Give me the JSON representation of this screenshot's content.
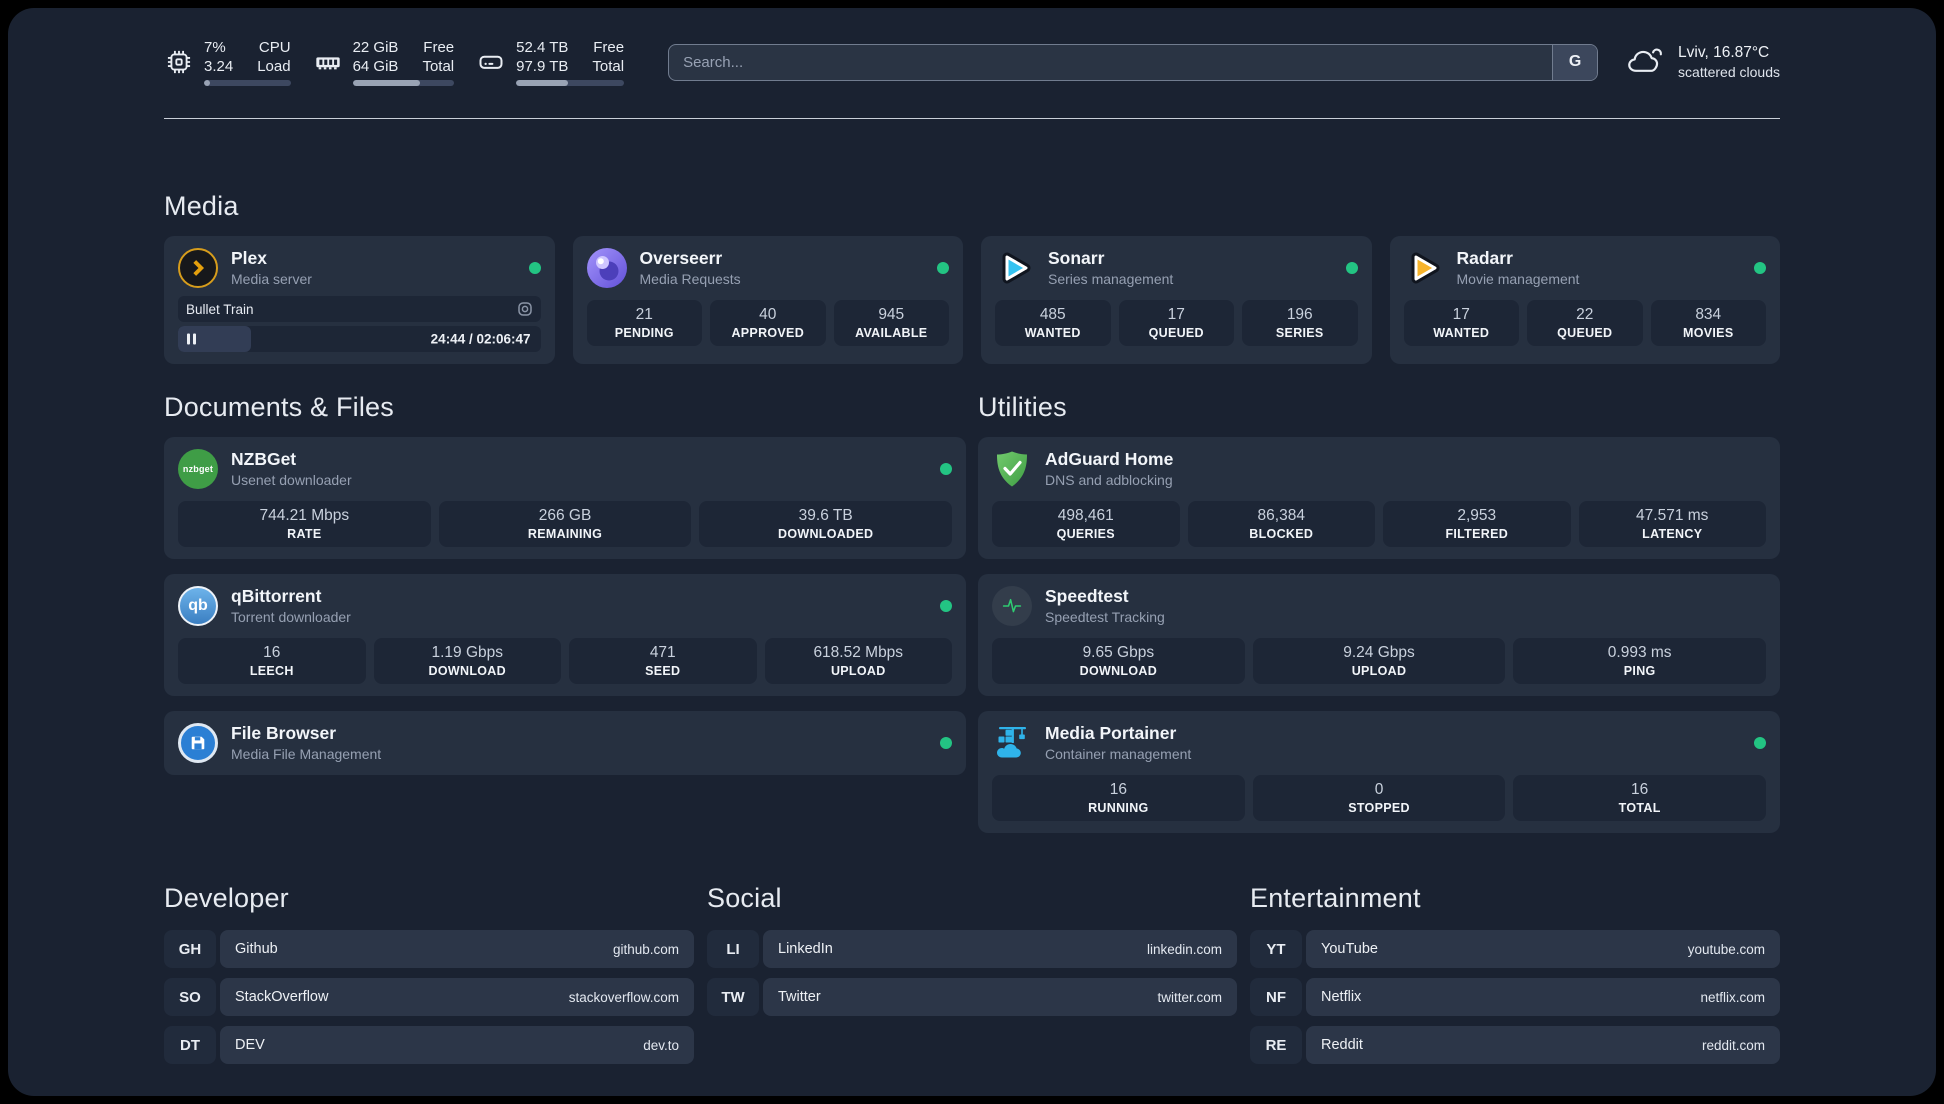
{
  "system": {
    "cpu": {
      "values": [
        "7%",
        "3.24"
      ],
      "labels": [
        "CPU",
        "Load"
      ],
      "progress": 7
    },
    "memory": {
      "values": [
        "22 GiB",
        "64 GiB"
      ],
      "labels": [
        "Free",
        "Total"
      ],
      "progress": 66
    },
    "storage": {
      "values": [
        "52.4 TB",
        "97.9 TB"
      ],
      "labels": [
        "Free",
        "Total"
      ],
      "progress": 48
    }
  },
  "search": {
    "placeholder": "Search...",
    "engine_button": "G"
  },
  "weather": {
    "location": "Lviv, 16.87°C",
    "condition": "scattered clouds"
  },
  "sections": {
    "media": "Media",
    "documents": "Documents & Files",
    "utilities": "Utilities",
    "developer": "Developer",
    "social": "Social",
    "entertainment": "Entertainment"
  },
  "apps": {
    "plex": {
      "name": "Plex",
      "description": "Media server",
      "now_playing": {
        "title": "Bullet Train",
        "time_display": "24:44 / 02:06:47",
        "progress": 20
      }
    },
    "overseerr": {
      "name": "Overseerr",
      "description": "Media Requests",
      "stats": [
        {
          "value": "21",
          "label": "PENDING"
        },
        {
          "value": "40",
          "label": "APPROVED"
        },
        {
          "value": "945",
          "label": "AVAILABLE"
        }
      ]
    },
    "sonarr": {
      "name": "Sonarr",
      "description": "Series management",
      "stats": [
        {
          "value": "485",
          "label": "WANTED"
        },
        {
          "value": "17",
          "label": "QUEUED"
        },
        {
          "value": "196",
          "label": "SERIES"
        }
      ]
    },
    "radarr": {
      "name": "Radarr",
      "description": "Movie management",
      "stats": [
        {
          "value": "17",
          "label": "WANTED"
        },
        {
          "value": "22",
          "label": "QUEUED"
        },
        {
          "value": "834",
          "label": "MOVIES"
        }
      ]
    },
    "nzbget": {
      "name": "NZBGet",
      "description": "Usenet downloader",
      "icon_text": "nzbget",
      "stats": [
        {
          "value": "744.21 Mbps",
          "label": "RATE"
        },
        {
          "value": "266 GB",
          "label": "REMAINING"
        },
        {
          "value": "39.6 TB",
          "label": "DOWNLOADED"
        }
      ]
    },
    "qbittorrent": {
      "name": "qBittorrent",
      "description": "Torrent downloader",
      "icon_text": "qb",
      "stats": [
        {
          "value": "16",
          "label": "LEECH"
        },
        {
          "value": "1.19 Gbps",
          "label": "DOWNLOAD"
        },
        {
          "value": "471",
          "label": "SEED"
        },
        {
          "value": "618.52 Mbps",
          "label": "UPLOAD"
        }
      ]
    },
    "filebrowser": {
      "name": "File Browser",
      "description": "Media File Management"
    },
    "adguard": {
      "name": "AdGuard Home",
      "description": "DNS and adblocking",
      "stats": [
        {
          "value": "498,461",
          "label": "QUERIES"
        },
        {
          "value": "86,384",
          "label": "BLOCKED"
        },
        {
          "value": "2,953",
          "label": "FILTERED"
        },
        {
          "value": "47.571 ms",
          "label": "LATENCY"
        }
      ]
    },
    "speedtest": {
      "name": "Speedtest",
      "description": "Speedtest Tracking",
      "stats": [
        {
          "value": "9.65 Gbps",
          "label": "DOWNLOAD"
        },
        {
          "value": "9.24 Gbps",
          "label": "UPLOAD"
        },
        {
          "value": "0.993 ms",
          "label": "PING"
        }
      ]
    },
    "portainer": {
      "name": "Media Portainer",
      "description": "Container management",
      "stats": [
        {
          "value": "16",
          "label": "RUNNING"
        },
        {
          "value": "0",
          "label": "STOPPED"
        },
        {
          "value": "16",
          "label": "TOTAL"
        }
      ]
    }
  },
  "bookmarks": {
    "developer": [
      {
        "abbr": "GH",
        "name": "Github",
        "url": "github.com"
      },
      {
        "abbr": "SO",
        "name": "StackOverflow",
        "url": "stackoverflow.com"
      },
      {
        "abbr": "DT",
        "name": "DEV",
        "url": "dev.to"
      }
    ],
    "social": [
      {
        "abbr": "LI",
        "name": "LinkedIn",
        "url": "linkedin.com"
      },
      {
        "abbr": "TW",
        "name": "Twitter",
        "url": "twitter.com"
      }
    ],
    "entertainment": [
      {
        "abbr": "YT",
        "name": "YouTube",
        "url": "youtube.com"
      },
      {
        "abbr": "NF",
        "name": "Netflix",
        "url": "netflix.com"
      },
      {
        "abbr": "RE",
        "name": "Reddit",
        "url": "reddit.com"
      }
    ]
  }
}
